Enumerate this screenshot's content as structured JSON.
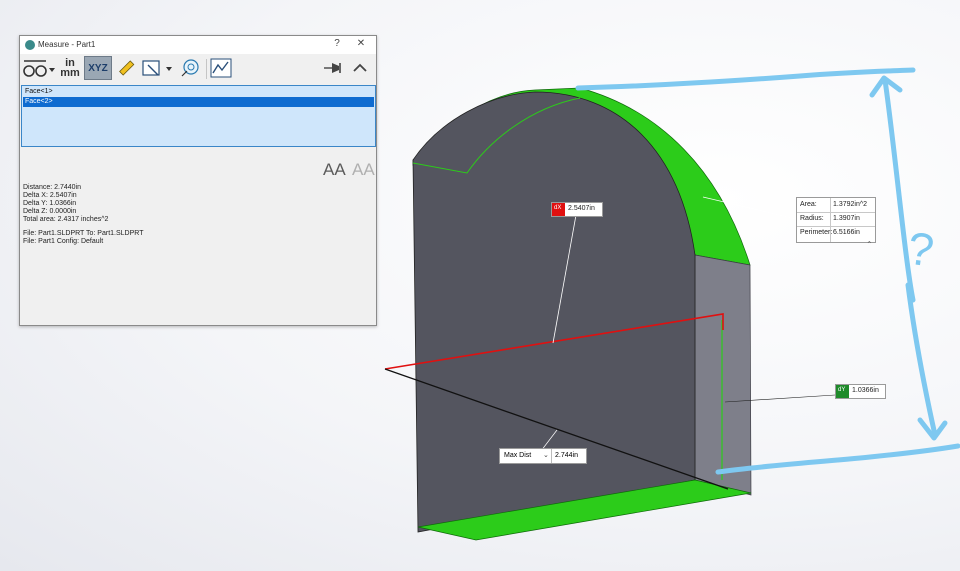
{
  "dialog": {
    "title": "Measure - Part1",
    "help_label": "?",
    "close_label": "✕",
    "in_label": "in",
    "mm_label": "mm",
    "xyz_label": "XYZ",
    "list_items": [
      {
        "label": "Face<1>",
        "selected": false
      },
      {
        "label": "Face<2>",
        "selected": true
      }
    ],
    "results": [
      "Distance: 2.7440in",
      "Delta X: 2.5407in",
      "Delta Y: 1.0366in",
      "Delta Z: 0.0000in",
      "Total area: 2.4317 inches^2",
      "",
      "File: Part1.SLDPRT To: Part1.SLDPRT",
      "File: Part1 Config: Default"
    ],
    "font_increase_label": "AA",
    "font_decrease_label": "AA"
  },
  "callouts": {
    "face_info": {
      "area_label": "Area:",
      "area_value": "1.3792in^2",
      "radius_label": "Radius:",
      "radius_value": "1.3907in",
      "perimeter_label": "Perimeter:",
      "perimeter_value": "6.5166in"
    },
    "dx": {
      "label": "dX",
      "value": "2.5407in",
      "color": "#e01010"
    },
    "dy": {
      "label": "dY",
      "value": "1.0366in",
      "color": "#1e8a2a"
    },
    "max_dist": {
      "label": "Max Dist",
      "value": "2.744in"
    }
  },
  "annotation": {
    "question_mark": "?",
    "color": "#7ec8f0"
  },
  "colors": {
    "face_dark": "#54555f",
    "face_side": "#7e7f8a",
    "face_green": "#2ccc1a",
    "accent_blue": "#0e6bd0"
  }
}
